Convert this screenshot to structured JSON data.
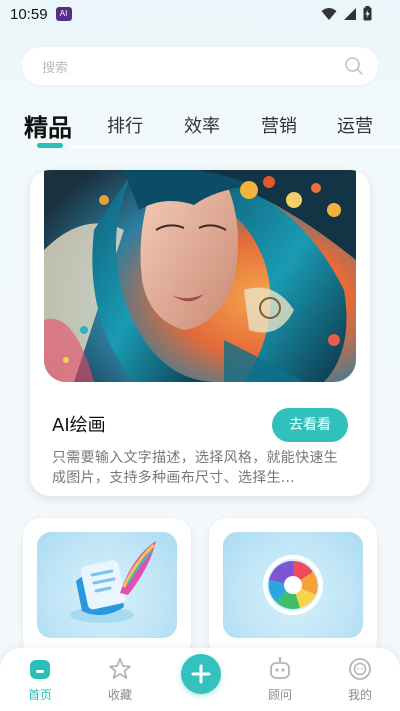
{
  "status_bar": {
    "time": "10:59",
    "app_icon_name": "app-notification-icon"
  },
  "search": {
    "placeholder": "搜索",
    "icon": "search-icon"
  },
  "tabs": [
    {
      "label": "精品",
      "active": true
    },
    {
      "label": "排行",
      "active": false
    },
    {
      "label": "效率",
      "active": false
    },
    {
      "label": "营销",
      "active": false
    },
    {
      "label": "运营",
      "active": false
    }
  ],
  "feature": {
    "image": "ai-portrait-illustration",
    "title": "AI绘画",
    "button_label": "去看看",
    "description": "只需要输入文字描述，选择风格，就能快速生成图片，支持多种画布尺寸、选择生..."
  },
  "mini_cards": [
    {
      "icon": "writing-quill-icon"
    },
    {
      "icon": "camera-aperture-icon"
    }
  ],
  "bottom_nav": [
    {
      "label": "首页",
      "icon": "home-icon",
      "active": true
    },
    {
      "label": "收藏",
      "icon": "star-icon",
      "active": false
    },
    {
      "label": "",
      "icon": "plus-icon",
      "active": false
    },
    {
      "label": "顾问",
      "icon": "robot-icon",
      "active": false
    },
    {
      "label": "我的",
      "icon": "profile-icon",
      "active": false
    }
  ],
  "colors": {
    "accent": "#2abfb8",
    "button": "#32c0bc",
    "background": "#eef7fa"
  }
}
